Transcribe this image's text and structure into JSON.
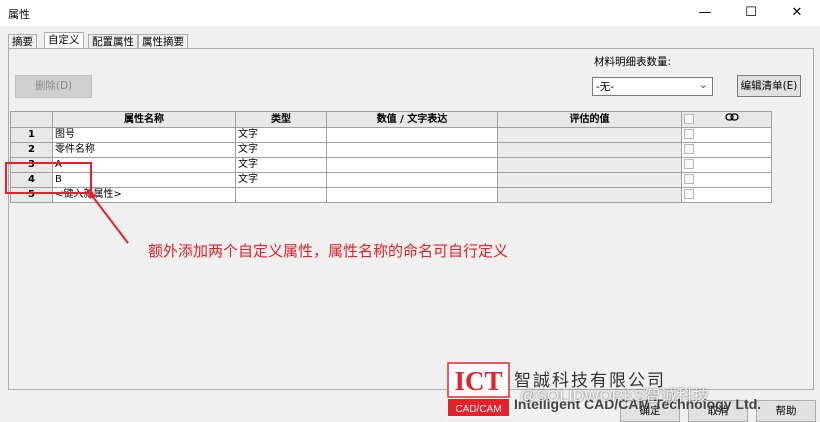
{
  "window": {
    "title": "属性",
    "minimize": "—",
    "maximize": "☐",
    "close": "✕"
  },
  "tabs": [
    "摘要",
    "自定义",
    "配置属性",
    "属性摘要"
  ],
  "delete_button": "删除(D)",
  "bom_label": "材料明细表数量:",
  "bom_select": "-无-",
  "edit_list_button": "编辑清单(E)",
  "table": {
    "headers": [
      "属性名称",
      "类型",
      "数值 / 文字表达",
      "评估的值"
    ],
    "rows": [
      {
        "num": "1",
        "name": "图号",
        "type": "文字"
      },
      {
        "num": "2",
        "name": "零件名称",
        "type": "文字"
      },
      {
        "num": "3",
        "name": "A",
        "type": "文字"
      },
      {
        "num": "4",
        "name": "B",
        "type": "文字"
      },
      {
        "num": "5",
        "name": "<键入新属性>",
        "type": ""
      }
    ]
  },
  "annotation": "额外添加两个自定义属性，属性名称的命名可自行定义",
  "logo": {
    "mark": "ICT",
    "sub": "CAD/CAM",
    "cn": "智誠科技有限公司",
    "en": "Intelligent CAD/CAM Technology Ltd.",
    "watermark": "@SOLIDWORKS智诚科技"
  },
  "bottom_buttons": [
    "确定",
    "取消",
    "帮助"
  ],
  "colors": {
    "accent_red": "#e8202a",
    "logo_red": "#e8202a"
  }
}
